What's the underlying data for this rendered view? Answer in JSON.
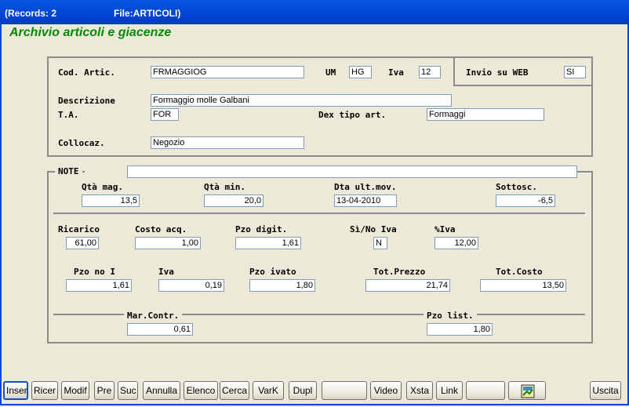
{
  "window": {
    "records": "(Records: 2",
    "file": "File:ARTICOLI)"
  },
  "app_title": "Archivio articoli e giacenze",
  "article": {
    "cod_label": "Cod. Artic.",
    "cod_value": "FRMAGGIOG",
    "um_label": "UM",
    "um_value": "HG",
    "iva_label": "Iva",
    "iva_value": "12",
    "web_label": "Invio su WEB",
    "web_value": "SI",
    "descr_label": "Descrizione",
    "descr_value": "Formaggio molle Galbani",
    "ta_label": "T.A.",
    "ta_value": "FOR",
    "dex_label": "Dex tipo art.",
    "dex_value": "Formaggi",
    "colloc_label": "Collocaz.",
    "colloc_value": "Negozio"
  },
  "stock": {
    "note_label": "NOTE",
    "note_value": "",
    "qta_mag_label": "Qtà mag.",
    "qta_mag_value": "13,5",
    "qta_min_label": "Qtà min.",
    "qta_min_value": "20,0",
    "dta_label": "Dta ult.mov.",
    "dta_value": "13-04-2010",
    "sottosc_label": "Sottosc.",
    "sottosc_value": "-6,5",
    "ricarico_label": "Ricarico",
    "ricarico_value": "61,00",
    "costo_label": "Costo acq.",
    "costo_value": "1,00",
    "pzo_digit_label": "Pzo digit.",
    "pzo_digit_value": "1,61",
    "sino_iva_label": "Sì/No Iva",
    "sino_iva_value": "N",
    "piva_label": "%Iva",
    "piva_value": "12,00",
    "pzo_noi_label": "Pzo no I",
    "pzo_noi_value": "1,61",
    "iva2_label": "Iva",
    "iva2_value": "0,19",
    "pzo_ivato_label": "Pzo ivato",
    "pzo_ivato_value": "1,80",
    "tot_prezzo_label": "Tot.Prezzo",
    "tot_prezzo_value": "21,74",
    "tot_costo_label": "Tot.Costo",
    "tot_costo_value": "13,50",
    "mar_label": "Mar.Contr.",
    "mar_value": "0,61",
    "pzo_list_label": "Pzo list.",
    "pzo_list_value": "1,80"
  },
  "toolbar": {
    "inser": "Inser",
    "ricer": "Ricer",
    "modif": "Modif",
    "pre": "Pre",
    "suc": "Suc",
    "annulla": "Annulla",
    "elenco": "Elenco",
    "cerca": "Cerca",
    "vark": "VarK",
    "dupl": "Dupl",
    "blank1": "",
    "video": "Video",
    "xsta": "Xsta",
    "link": "Link",
    "blank2": "",
    "uscita": "Uscita",
    "image_icon": "calculator-image-icon"
  }
}
